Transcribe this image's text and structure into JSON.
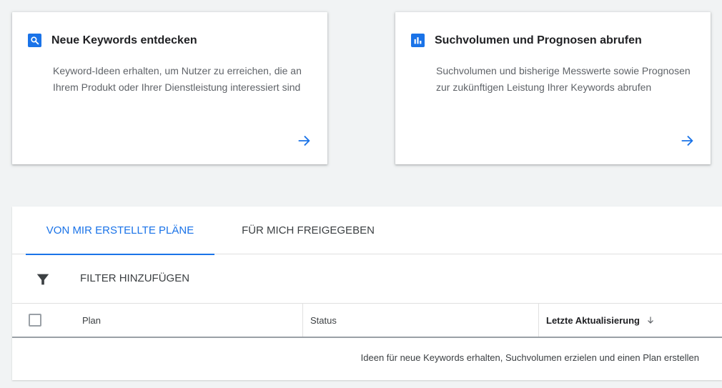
{
  "cards": [
    {
      "title": "Neue Keywords entdecken",
      "description": "Keyword-Ideen erhalten, um Nutzer zu erreichen, die an Ihrem Produkt oder Ihrer Dienstleistung interessiert sind",
      "icon": "search-icon"
    },
    {
      "title": "Suchvolumen und Prognosen abrufen",
      "description": "Suchvolumen und bisherige Messwerte sowie Prognosen zur zukünftigen Leistung Ihrer Keywords abrufen",
      "icon": "bar-chart-icon"
    }
  ],
  "tabs": [
    {
      "label": "VON MIR ERSTELLTE PLÄNE",
      "active": true
    },
    {
      "label": "FÜR MICH FREIGEGEBEN",
      "active": false
    }
  ],
  "filter": {
    "label": "FILTER HINZUFÜGEN",
    "icon": "filter-icon"
  },
  "table": {
    "columns": [
      "Plan",
      "Status",
      "Letzte Aktualisierung"
    ],
    "sort_icon": "arrow-down-icon",
    "empty_message": "Ideen für neue Keywords erhalten, Suchvolumen erzielen und einen Plan erstellen"
  },
  "colors": {
    "accent": "#1a73e8",
    "background": "#f1f3f4"
  }
}
